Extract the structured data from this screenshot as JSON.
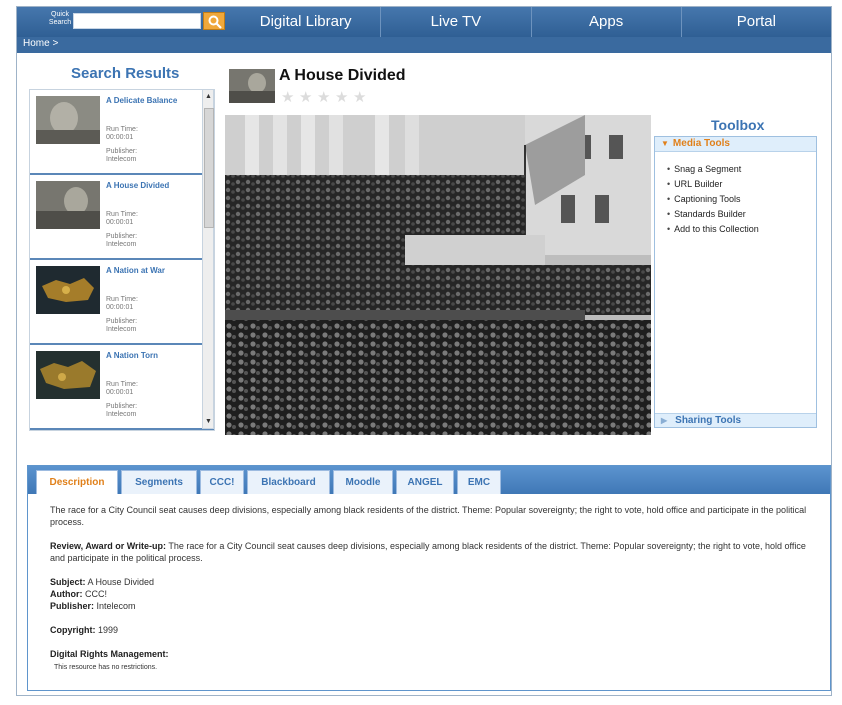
{
  "topnav": {
    "quick_search_label": "Quick Search",
    "quick_search_value": "",
    "links": [
      "Digital Library",
      "Live TV",
      "Apps",
      "Portal"
    ]
  },
  "breadcrumb": "Home >",
  "search_results": {
    "title": "Search Results",
    "items": [
      {
        "title": "A Delicate Balance",
        "run_time_label": "Run Time:",
        "run_time": "00:00:01",
        "publisher_label": "Publisher:",
        "publisher": "Intelecom"
      },
      {
        "title": "A House Divided",
        "run_time_label": "Run Time:",
        "run_time": "00:00:01",
        "publisher_label": "Publisher:",
        "publisher": "Intelecom"
      },
      {
        "title": "A Nation at War",
        "run_time_label": "Run Time:",
        "run_time": "00:00:01",
        "publisher_label": "Publisher:",
        "publisher": "Intelecom"
      },
      {
        "title": "A Nation Torn",
        "run_time_label": "Run Time:",
        "run_time": "00:00:01",
        "publisher_label": "Publisher:",
        "publisher": "Intelecom"
      }
    ]
  },
  "video": {
    "title": "A House Divided",
    "rating_stars": 0,
    "rating_max": 5
  },
  "toolbox": {
    "title": "Toolbox",
    "media_tools_label": "Media Tools",
    "media_tools": [
      "Snag a Segment",
      "URL Builder",
      "Captioning Tools",
      "Standards Builder",
      "Add to this Collection"
    ],
    "sharing_tools_label": "Sharing Tools"
  },
  "tabs": {
    "items": [
      "Description",
      "Segments",
      "CCC!",
      "Blackboard",
      "Moodle",
      "ANGEL",
      "EMC"
    ],
    "active": "Description"
  },
  "description": {
    "summary": "The race for a City Council seat causes deep divisions, especially among black residents of the district. Theme: Popular sovereignty; the right to vote, hold office and participate in the political process.",
    "review_label": "Review, Award or Write-up:",
    "review_text": " The race for a City Council seat causes deep divisions, especially among black residents of the district. Theme: Popular sovereignty; the right to vote, hold office and participate in the political process.",
    "subject_label": "Subject:",
    "subject": " A House Divided",
    "author_label": "Author:",
    "author": " CCC!",
    "publisher_label": "Publisher:",
    "publisher": " Intelecom",
    "copyright_label": "Copyright:",
    "copyright": " 1999",
    "drm_label": "Digital Rights Management:",
    "drm_note": "This resource has no restrictions."
  },
  "colors": {
    "nav_bg": "#3b6ea5",
    "link_blue": "#3c74b3",
    "accent_orange": "#e0801a"
  }
}
